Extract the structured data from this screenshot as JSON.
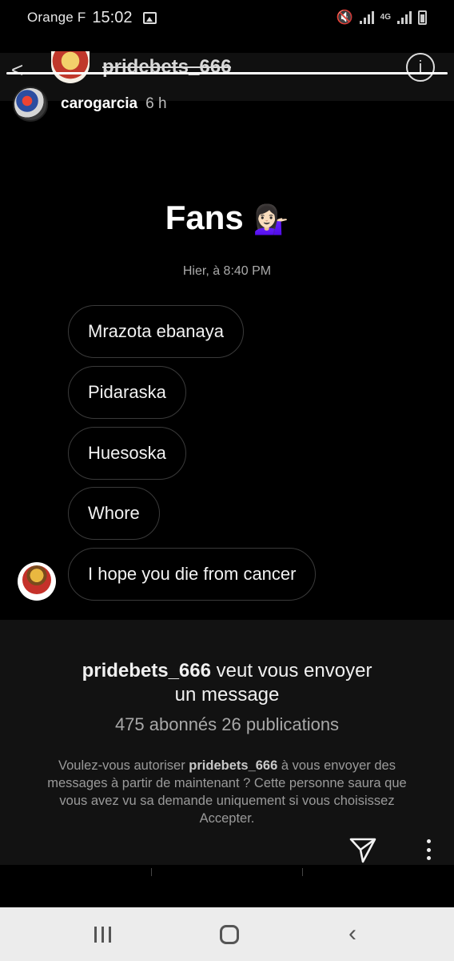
{
  "status_bar": {
    "carrier": "Orange F",
    "time": "15:02",
    "network": "4G"
  },
  "story": {
    "behind_title": "pridebets_666",
    "user": "carogarcia",
    "age": "6 h",
    "progress": 1.0
  },
  "chat": {
    "title": "Fans",
    "title_emoji": "💁🏻‍♀️",
    "date": "Hier, à 8:40 PM",
    "messages": [
      "Mrazota ebanaya",
      "Pidaraska",
      "Huesoska",
      "Whore",
      "I hope you die from cancer"
    ]
  },
  "request": {
    "username": "pridebets_666",
    "line1_rest": " veut vous envoyer",
    "line2": "un message",
    "stats": "475 abonnés 26 publications",
    "body_pre": "Voulez-vous autoriser ",
    "body_user": "pridebets_666",
    "body_post": " à vous envoyer des messages à partir de maintenant ? Cette personne saura que vous avez vu sa demande uniquement si vous choisissez Accepter."
  },
  "icons": {
    "send": "send-icon",
    "more": "more-vertical-icon",
    "info": "info-icon",
    "back": "back-chevron-icon"
  }
}
